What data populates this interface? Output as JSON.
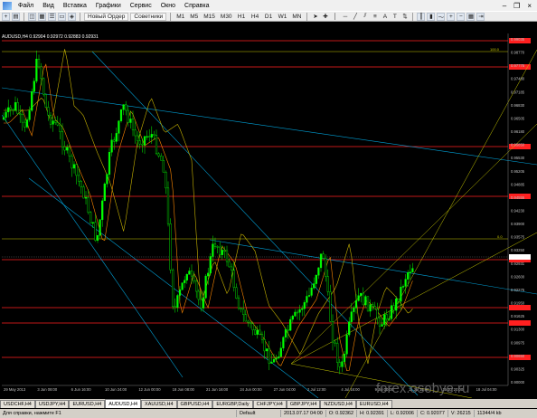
{
  "menu": [
    "Файл",
    "Вид",
    "Вставка",
    "Графики",
    "Сервис",
    "Окно",
    "Справка"
  ],
  "toolbar": {
    "new_order": "Новый Ордер",
    "experts": "Советники",
    "timeframes": [
      "M1",
      "M5",
      "M15",
      "M30",
      "H1",
      "H4",
      "D1",
      "W1",
      "MN"
    ]
  },
  "chart": {
    "title": "AUDUSD,H4  0.92904 0.92972 0.92883 0.92931",
    "price_labels": [
      "0.99035",
      "0.98770",
      "0.97775",
      "0.97480",
      "0.97185",
      "0.96830",
      "0.96505",
      "0.96180",
      "0.95850",
      "0.95530",
      "0.95205",
      "0.94885",
      "0.94555",
      "0.94230",
      "0.93900",
      "0.93575",
      "0.93250",
      "0.92931",
      "0.92600",
      "0.92275",
      "0.91950",
      "0.91625",
      "0.91300",
      "0.90975",
      "0.90650",
      "0.90325",
      "0.90000"
    ],
    "time_labels": [
      "29 May 2013",
      "3 Jun 08:00",
      "6 Jun 16:00",
      "10 Jun 24:00",
      "12 Jun 00:00",
      "18 Jun 08:00",
      "21 Jun 16:00",
      "24 Jun 00:00",
      "27 Jun 04:00",
      "2 Jul 12:00",
      "4 Jul 16:00",
      "9 Jul 00:00",
      "11 Jul 12:00",
      "15 Jul 20:00",
      "18 Jul 04:00"
    ],
    "fib_labels": [
      "100.0",
      "0.0"
    ],
    "colors": {
      "bull": "#00ff00",
      "bear": "#00ff00",
      "level": "#ff2020",
      "channel": "#00bfff",
      "fib": "#c8c800",
      "ma1": "#ff8800",
      "ma2": "#c8b400"
    }
  },
  "tabs": [
    "USDCHF,H4",
    "USDJPY,H4",
    "EURUSD,H4",
    "AUDUSD,H4",
    "XAUUSD,H4",
    "GBPUSD,H4",
    "EURGBP,Daily",
    "CHFJPY,H4",
    "GBPJPY,H4",
    "NZDUSD,H4",
    "EURUSD,H4"
  ],
  "active_tab": 3,
  "status": {
    "help": "Для справки, нажмите F1",
    "profile": "Default",
    "datetime": "2013.07.17 04:00",
    "open": "O: 0.92362",
    "high": "H: 0.92391",
    "low": "L: 0.92006",
    "close": "C: 0.92077",
    "volume": "V: 26215",
    "traffic": "11344/4 kb"
  },
  "watermark": "forex.osobye.ru"
}
